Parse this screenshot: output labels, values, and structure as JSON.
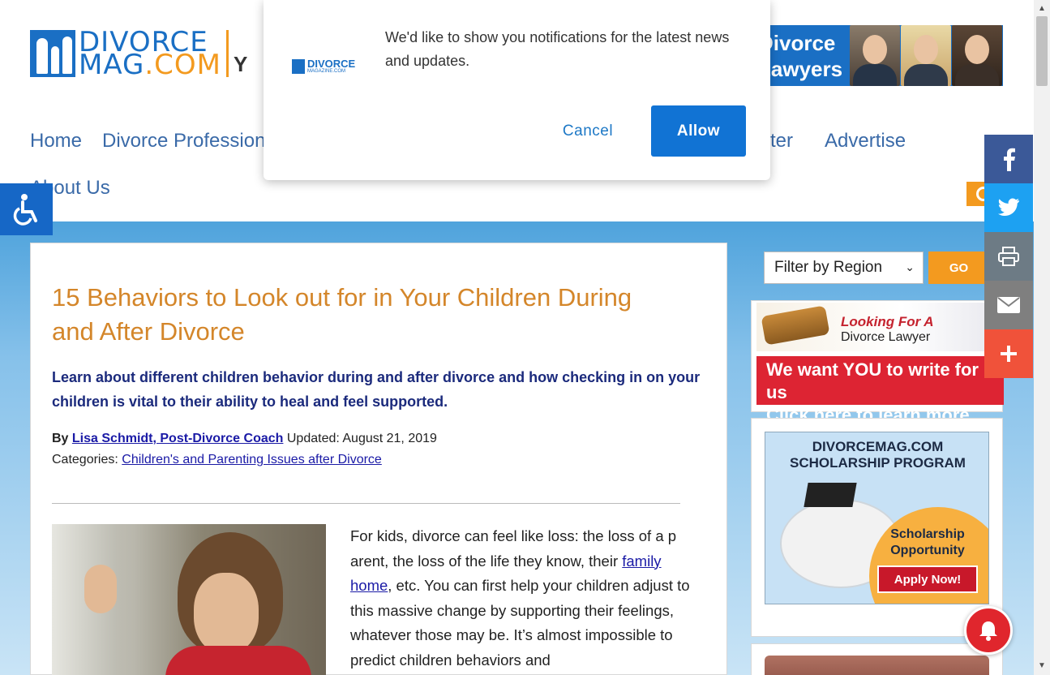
{
  "header": {
    "logo": {
      "line1_a": "DIVORCE",
      "line2_a": "MAG",
      "line2_b": ".COM",
      "tail": "Y"
    },
    "lawyer_banner": {
      "text_line1": "Divorce",
      "text_line2": "Lawyers"
    },
    "nav": [
      {
        "label": "Home"
      },
      {
        "label": "Divorce Profession"
      },
      {
        "label": "etter"
      },
      {
        "label": "Advertise"
      },
      {
        "label": "About Us"
      }
    ],
    "search_icon": "search-icon"
  },
  "accessibility": {
    "icon": "wheelchair-icon"
  },
  "article": {
    "title": "15 Behaviors to Look out for in Your Children During and After Divorce",
    "lead": "Learn about different children behavior during and after divorce and how checking in on your children is vital to their ability to heal and feel supported.",
    "byline": {
      "by": "By",
      "author": "Lisa Schmidt, Post-Divorce Coach",
      "updated": "Updated: August 21, 2019"
    },
    "categories": {
      "label": "Categories:",
      "link": "Children's and Parenting Issues after Divorce"
    },
    "body": {
      "part1": "For kids, divorce can feel like loss: the loss of a p arent, the loss of the life they know, their ",
      "link": "family home",
      "part2": ", etc. You can first help your children adjust to this massive change by supporting their feelings, whatever those may be. It’s almost impossible to predict children behaviors and"
    }
  },
  "sidebar": {
    "region_select": {
      "value": "Filter by Region"
    },
    "go_label": "GO",
    "ad1": {
      "looking": "Looking For A",
      "lawyer": "Divorce Lawyer",
      "write1": "We want YOU to write for us",
      "write2": "Click here to learn more..."
    },
    "ad2": {
      "heading1": "DIVORCEMAG.COM",
      "heading2": "SCHOLARSHIP PROGRAM",
      "sch1": "Scholarship",
      "sch2": "Opportunity",
      "apply": "Apply Now!"
    }
  },
  "share": [
    {
      "icon": "facebook-icon",
      "color": "#3b5998"
    },
    {
      "icon": "twitter-icon",
      "color": "#1da1f2"
    },
    {
      "icon": "print-icon",
      "color": "#6d7b85"
    },
    {
      "icon": "email-icon",
      "color": "#7f7f7f"
    },
    {
      "icon": "plus-icon",
      "color": "#f0523a"
    }
  ],
  "prompt": {
    "logo_text1": "DIVORCE",
    "logo_text2": "MAGAZINE.COM",
    "message": "We'd like to show you notifications for the latest news and updates.",
    "cancel": "Cancel",
    "allow": "Allow"
  },
  "colors": {
    "brand_blue": "#1a6fc4",
    "brand_orange": "#f39a1f",
    "title_orange": "#d4862a",
    "lead_navy": "#1b2a7c",
    "allow_blue": "#1173d4"
  }
}
